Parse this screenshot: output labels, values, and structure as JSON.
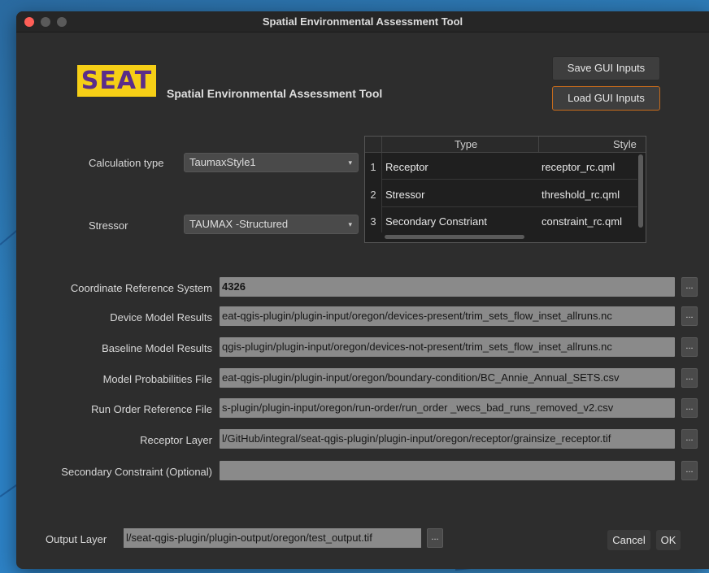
{
  "window": {
    "title": "Spatial Environmental Assessment Tool"
  },
  "header": {
    "logo_text": "SEAT",
    "app_title": "Spatial Environmental Assessment Tool",
    "save_label": "Save GUI Inputs",
    "load_label": "Load GUI Inputs"
  },
  "calc": {
    "calc_type_label": "Calculation type",
    "calc_type_value": "TaumaxStyle1",
    "stressor_label": "Stressor",
    "stressor_value": "TAUMAX -Structured"
  },
  "style_table": {
    "headers": [
      "Type",
      "Style"
    ],
    "rows": [
      {
        "num": "1",
        "type": "Receptor",
        "style": "receptor_rc.qml"
      },
      {
        "num": "2",
        "type": "Stressor",
        "style": "threshold_rc.qml"
      },
      {
        "num": "3",
        "type": "Secondary Constriant",
        "style": "constraint_rc.qml"
      }
    ]
  },
  "inputs": [
    {
      "label": "Coordinate Reference System",
      "value": "4326"
    },
    {
      "label": "Device Model Results",
      "value": "eat-qgis-plugin/plugin-input/oregon/devices-present/trim_sets_flow_inset_allruns.nc"
    },
    {
      "label": "Baseline Model Results",
      "value": "qgis-plugin/plugin-input/oregon/devices-not-present/trim_sets_flow_inset_allruns.nc"
    },
    {
      "label": "Model Probabilities File",
      "value": "eat-qgis-plugin/plugin-input/oregon/boundary-condition/BC_Annie_Annual_SETS.csv"
    },
    {
      "label": "Run Order Reference File",
      "value": "s-plugin/plugin-input/oregon/run-order/run_order _wecs_bad_runs_removed_v2.csv"
    },
    {
      "label": "Receptor Layer",
      "value": "l/GitHub/integral/seat-qgis-plugin/plugin-input/oregon/receptor/grainsize_receptor.tif"
    },
    {
      "label": "Secondary Constraint (Optional)",
      "value": ""
    }
  ],
  "browse_label": "...",
  "output": {
    "label": "Output Layer",
    "value": "l/seat-qgis-plugin/plugin-output/oregon/test_output.tif"
  },
  "footer": {
    "cancel_label": "Cancel",
    "ok_label": "OK"
  }
}
